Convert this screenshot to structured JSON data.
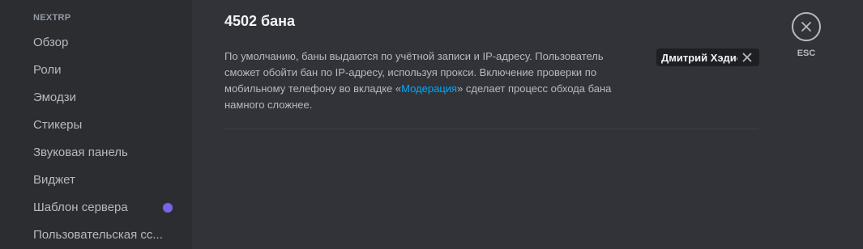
{
  "sidebar": {
    "header": "NEXTRP",
    "items": [
      {
        "label": "Обзор"
      },
      {
        "label": "Роли"
      },
      {
        "label": "Эмодзи"
      },
      {
        "label": "Стикеры"
      },
      {
        "label": "Звуковая панель"
      },
      {
        "label": "Виджет"
      },
      {
        "label": "Шаблон сервера"
      },
      {
        "label": "Пользовательская сс..."
      }
    ]
  },
  "main": {
    "title": "4502 бана",
    "description": {
      "before_link": "По умолчанию, баны выдаются по учётной записи и IP-адресу. Пользователь сможет обойти бан по IP-адресу, используя прокси. Включение проверки по мобильному телефону во вкладке «",
      "link": "Модерация",
      "after_link": "» сделает процесс обхода бана намного сложнее."
    },
    "user_chip": {
      "label": "Дмитрий Хэдис",
      "close_icon": "close-icon"
    },
    "close": {
      "label": "ESC",
      "icon": "close-icon"
    }
  },
  "colors": {
    "sidebar_bg": "#2b2d31",
    "main_bg": "#313338",
    "link": "#00a8fc",
    "unread_dot": "#7a63e8"
  }
}
